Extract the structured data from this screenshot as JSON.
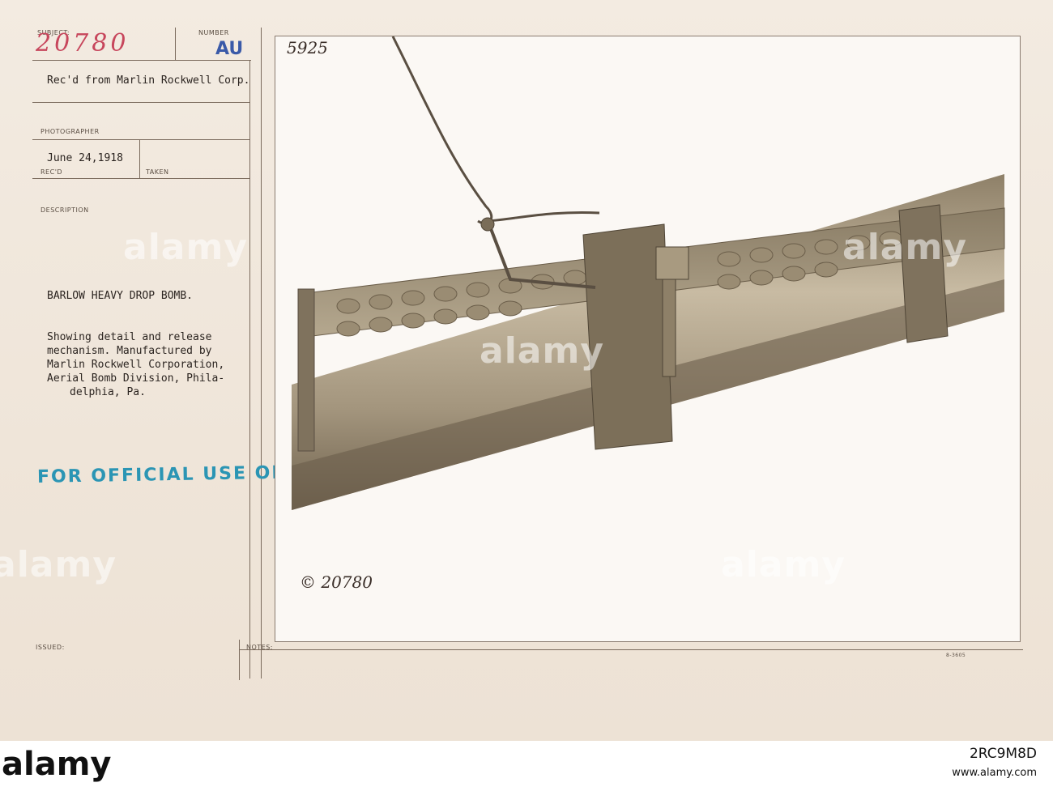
{
  "form": {
    "subject_label": "SUBJECT:",
    "subject_value": "20780",
    "number_label": "NUMBER",
    "number_value": "AU",
    "received_from": "Rec'd from Marlin Rockwell Corp.",
    "photographer_label": "PHOTOGRAPHER",
    "date": "June 24,1918",
    "recd_label": "REC'D",
    "taken_label": "TAKEN",
    "description_label": "DESCRIPTION",
    "title": "BARLOW HEAVY DROP BOMB.",
    "description_lines": [
      "Showing detail and release",
      "mechanism. Manufactured by",
      "Marlin Rockwell Corporation,",
      "Aerial Bomb Division, Phila-",
      "delphia, Pa."
    ],
    "official_stamp": "FOR OFFICIAL USE ONLY",
    "issued_label": "ISSUED:",
    "notes_label": "NOTES:",
    "form_number": "8-3605"
  },
  "photo": {
    "top_number": "5925",
    "bottom_number": "© 20780"
  },
  "watermark": {
    "text": "alamy",
    "bottom_brand": "alamy",
    "image_id": "2RC9M8D",
    "url": "www.alamy.com"
  },
  "colors": {
    "card": "#efe5d9",
    "red_stamp": "#c7465c",
    "blue_stamp": "#2b95b4",
    "au_stamp": "#3a5aa8"
  }
}
